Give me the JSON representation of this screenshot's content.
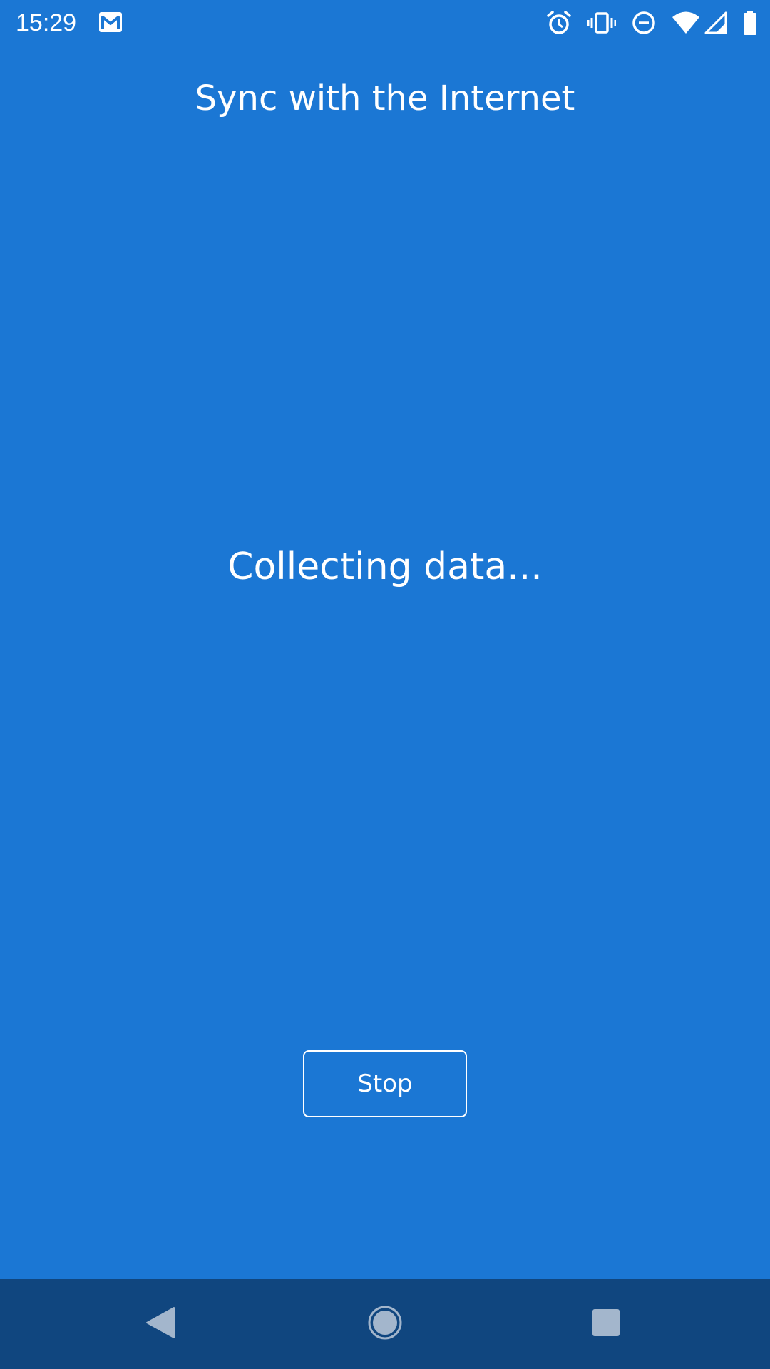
{
  "status_bar": {
    "time": "15:29",
    "notification_icons": [
      "gmail-icon"
    ],
    "system_icons": [
      "alarm-icon",
      "vibrate-icon",
      "do-not-disturb-icon",
      "wifi-icon",
      "signal-icon",
      "battery-icon"
    ]
  },
  "screen": {
    "title": "Sync with the Internet",
    "status_message": "Collecting data...",
    "stop_label": "Stop"
  },
  "nav_bar": {
    "buttons": [
      "back-icon",
      "home-icon",
      "recents-icon"
    ]
  },
  "colors": {
    "background": "#1B77D4",
    "nav_background": "#10467F",
    "text": "#FFFFFF",
    "nav_icon": "#A3B6CC"
  }
}
